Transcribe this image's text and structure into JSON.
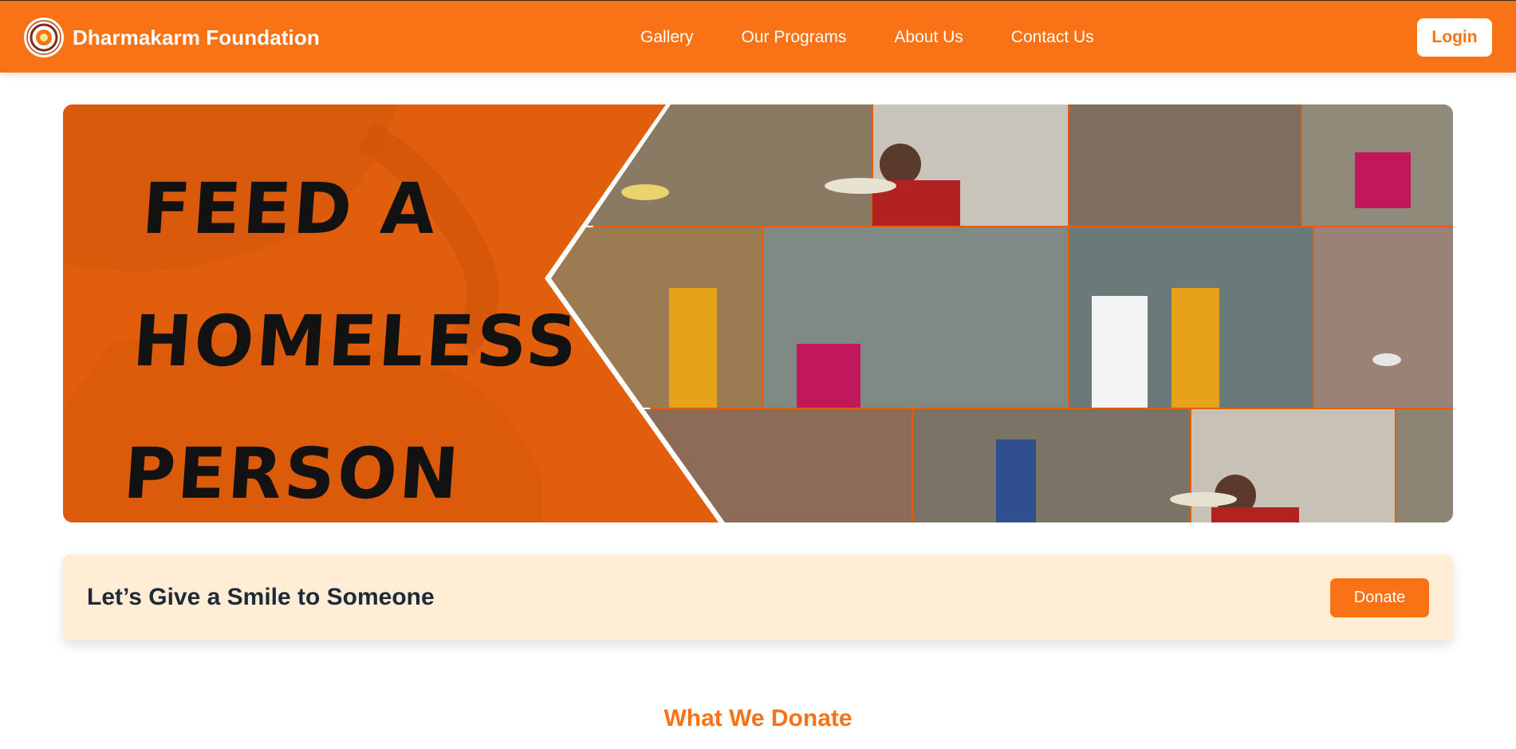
{
  "navbar": {
    "brand_name": "Dharmakarm Foundation",
    "links": [
      "Gallery",
      "Our Programs",
      "About Us",
      "Contact Us"
    ],
    "login_label": "Login"
  },
  "hero": {
    "title_lines": [
      "FEED A",
      "HOMELESS",
      "PERSON"
    ]
  },
  "banner": {
    "text": "Let’s Give a Smile to Someone",
    "donate_label": "Donate"
  },
  "section": {
    "title": "What We Donate"
  },
  "colors": {
    "primary": "#f97316",
    "hero_orange": "#e15e0c",
    "banner_bg": "#ffedd5",
    "text_dark": "#1f2937"
  }
}
